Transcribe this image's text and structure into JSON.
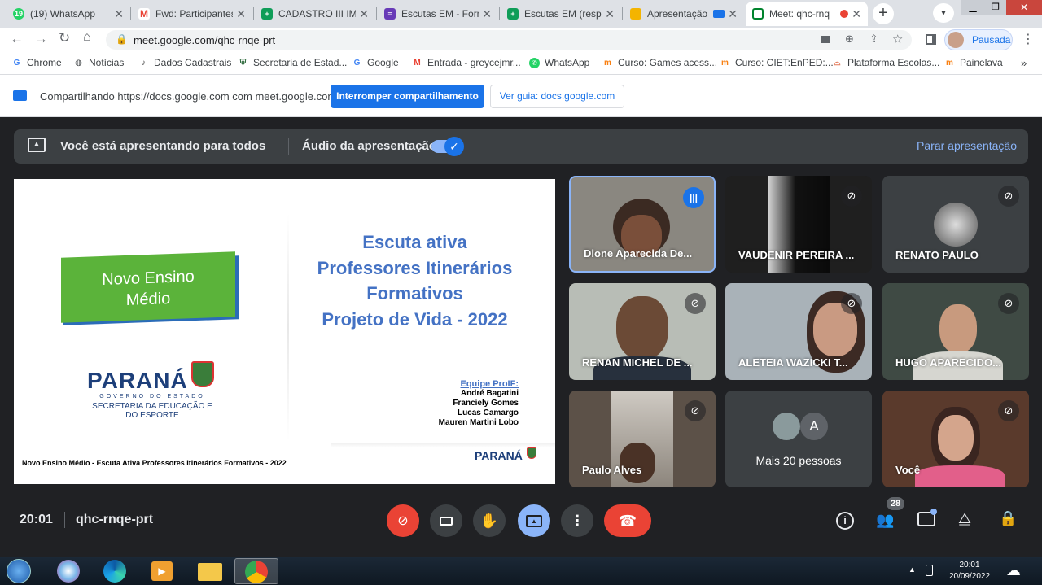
{
  "tabs": [
    {
      "label": "(19) WhatsApp",
      "icon": "whatsapp-icon",
      "color": "#25d366",
      "badge": "19"
    },
    {
      "label": "Fwd: Participantes",
      "icon": "gmail-icon",
      "color": "#ea4335",
      "badge": "M"
    },
    {
      "label": "CADASTRO III IME",
      "icon": "sheets-icon",
      "color": "#0f9d58",
      "badge": "+"
    },
    {
      "label": "Escutas EM - Form",
      "icon": "forms-icon",
      "color": "#673ab7",
      "badge": "≡"
    },
    {
      "label": "Escutas EM (respo",
      "icon": "sheets-icon",
      "color": "#0f9d58",
      "badge": "+"
    },
    {
      "label": "Apresentação",
      "icon": "slides-icon",
      "color": "#f4b400",
      "badge": ""
    },
    {
      "label": "Meet: qhc-rnq",
      "icon": "meet-icon",
      "color": "#00832d",
      "badge": ""
    }
  ],
  "url": "meet.google.com/qhc-rnqe-prt",
  "profile_label": "Pausada",
  "bookmarks": [
    {
      "label": "Chrome",
      "icon": "google-icon"
    },
    {
      "label": "Notícias",
      "icon": "globe-icon"
    },
    {
      "label": "Dados Cadastrais",
      "icon": "note-icon"
    },
    {
      "label": "Secretaria de Estad...",
      "icon": "shield-icon"
    },
    {
      "label": "Google",
      "icon": "google-icon"
    },
    {
      "label": "Entrada - greycejmr...",
      "icon": "gmail-icon"
    },
    {
      "label": "WhatsApp",
      "icon": "whatsapp-icon"
    },
    {
      "label": "Curso: Games acess...",
      "icon": "moodle-icon"
    },
    {
      "label": "Curso: CIET:EnPED:...",
      "icon": "moodle-icon"
    },
    {
      "label": "Plataforma Escolas...",
      "icon": "hat-icon"
    },
    {
      "label": "Painelava",
      "icon": "moodle-icon"
    }
  ],
  "sharebar": {
    "text": "Compartilhando https://docs.google.com com meet.google.com",
    "stop_label": "Interromper compartilhamento",
    "guide_label": "Ver guia: docs.google.com"
  },
  "presentation": {
    "banner_text": "Você está apresentando para todos",
    "audio_label": "Áudio da apresentação",
    "stop_label": "Parar apresentação"
  },
  "slide": {
    "badge_text": "Novo Ensino Médio",
    "logo_text": "PARANÁ",
    "logo_sub": "GOVERNO DO ESTADO",
    "logo_dept": "SECRETARIA DA EDUCAÇÃO E DO ESPORTE",
    "title_lines": [
      "Escuta ativa",
      "Professores Itinerários",
      "Formativos",
      "Projeto de Vida - 2022"
    ],
    "team_label": "Equipe ProIF:",
    "team": [
      "André Bagatini",
      "Franciely Gomes",
      "Lucas Camargo",
      "Mauren Martini Lobo"
    ],
    "footer": "Novo Ensino Médio - Escuta Ativa Professores Itinerários Formativos - 2022",
    "small_logo": "PARANÁ"
  },
  "participants": [
    {
      "name": "Dione Aparecida De...",
      "speaking": true
    },
    {
      "name": "VAUDENIR PEREIRA ...",
      "speaking": false
    },
    {
      "name": "RENATO PAULO",
      "speaking": false
    },
    {
      "name": "RENAN MICHEL DE ...",
      "speaking": false
    },
    {
      "name": "ALETEIA WAZICKI T...",
      "speaking": false
    },
    {
      "name": "HUGO APARECIDO...",
      "speaking": false
    },
    {
      "name": "Paulo Alves",
      "speaking": false
    },
    {
      "name": "Mais 20 pessoas",
      "speaking": false,
      "avatar_letter": "A"
    },
    {
      "name": "Você",
      "speaking": false
    }
  ],
  "meeting": {
    "time": "20:01",
    "code": "qhc-rnqe-prt",
    "participant_count": "28"
  },
  "taskbar": {
    "time": "20:01",
    "date": "20/09/2022"
  },
  "colors": {
    "accent_blue": "#1a73e8",
    "end_call_red": "#ea4335",
    "meet_bg": "#202124",
    "slide_title_blue": "#4472c4",
    "badge_green": "#5bb33a"
  }
}
